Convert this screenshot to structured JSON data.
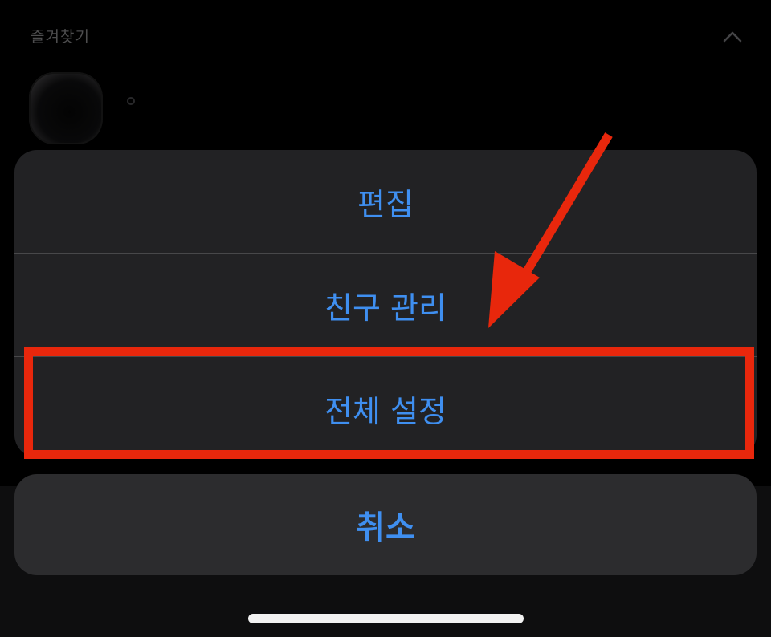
{
  "favorites": {
    "title": "즐겨찾기"
  },
  "action_sheet": {
    "items": [
      {
        "label": "편집"
      },
      {
        "label": "친구 관리"
      },
      {
        "label": "전체 설정"
      }
    ],
    "cancel_label": "취소"
  },
  "colors": {
    "accent": "#3f8ff0",
    "annotation": "#e8270c",
    "sheet_background": "#222224",
    "cancel_background": "#2c2c2e"
  },
  "icons": {
    "collapse": "chevron-up-icon",
    "annotation_arrow": "arrow-icon"
  }
}
